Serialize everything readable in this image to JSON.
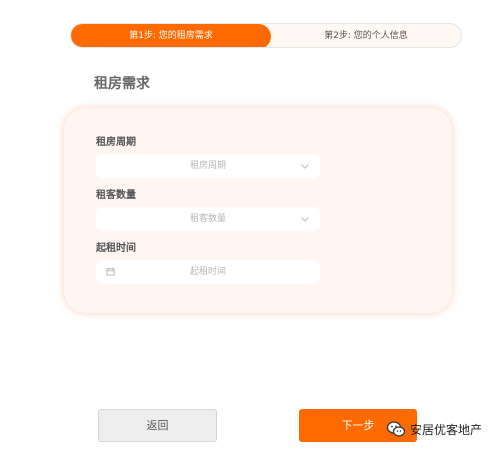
{
  "stepper": {
    "step1_label": "第1步: 您的租房需求",
    "step2_label": "第2步: 您的个人信息"
  },
  "section": {
    "title": "租房需求"
  },
  "form": {
    "lease_period": {
      "label": "租房周期",
      "placeholder": "租房周期",
      "icon": "chevron-down-icon"
    },
    "tenant_count": {
      "label": "租客数量",
      "placeholder": "租客数量",
      "icon": "chevron-down-icon"
    },
    "start_date": {
      "label": "起租时间",
      "placeholder": "起租时间",
      "icon": "calendar-icon"
    }
  },
  "buttons": {
    "back_label": "返回",
    "next_label": "下一步"
  },
  "watermark": {
    "text": "安居优客地产",
    "icon": "wechat-icon"
  },
  "colors": {
    "accent": "#ff6a00",
    "card_bg": "#fff6f1",
    "muted": "#b5b5b5"
  }
}
